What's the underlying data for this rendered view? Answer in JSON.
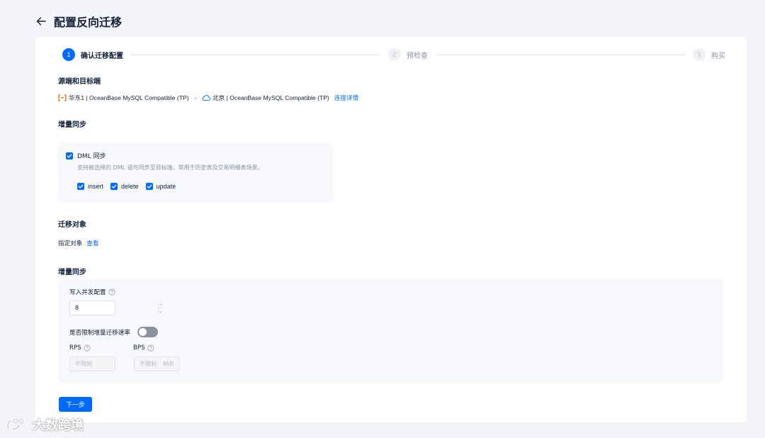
{
  "header": {
    "title": "配置反向迁移"
  },
  "steps": [
    {
      "num": "1",
      "label": "确认迁移配置"
    },
    {
      "num": "2",
      "label": "预检查"
    },
    {
      "num": "3",
      "label": "购买"
    }
  ],
  "endpoints": {
    "section_title": "源端和目标端",
    "source": "华东1 | OceanBase MySQL Compatible (TP)",
    "arrow": "»",
    "target": "北京 | OceanBase MySQL Compatible (TP)",
    "detail_link": "连接详情"
  },
  "incremental_sync": {
    "section_title": "增量同步",
    "dml_label": "DML 同步",
    "dml_desc": "支持被选择的 DML 语句同步至目标端，常用于历史表及交易明细表场景。",
    "ops": [
      "insert",
      "delete",
      "update"
    ]
  },
  "objects": {
    "section_title": "迁移对象",
    "label": "指定对象",
    "view_link": "查看"
  },
  "incremental_config": {
    "section_title": "增量同步",
    "concurrency_label": "写入并发配置",
    "concurrency_value": "8",
    "limit_label": "是否限制增量迁移速率",
    "limit_enabled": false,
    "rps_label": "RPS",
    "rps_placeholder": "不限制",
    "bps_label": "BPS",
    "bps_placeholder": "不限制",
    "bps_unit": "MiB"
  },
  "actions": {
    "next_label": "下一步"
  },
  "watermark": {
    "text": "大数跨境"
  },
  "colors": {
    "primary": "#006aff",
    "background": "#f2f4f8",
    "panel": "#f6f8fb"
  }
}
